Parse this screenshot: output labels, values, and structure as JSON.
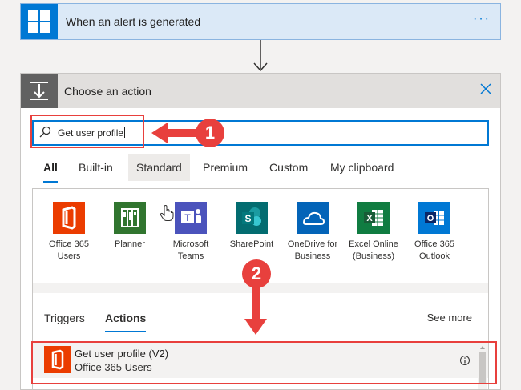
{
  "trigger": {
    "title": "When an alert is generated",
    "more": "···"
  },
  "action": {
    "title": "Choose an action",
    "search": {
      "value": "Get user profile"
    },
    "tabs": [
      "All",
      "Built-in",
      "Standard",
      "Premium",
      "Custom",
      "My clipboard"
    ],
    "connectors": [
      {
        "label": "Office 365 Users",
        "icon": "office-365-icon",
        "color": "#eb3c00"
      },
      {
        "label": "Planner",
        "icon": "planner-icon",
        "color": "#31752f"
      },
      {
        "label": "Microsoft Teams",
        "icon": "teams-icon",
        "color": "#4b53bc"
      },
      {
        "label": "SharePoint",
        "icon": "sharepoint-icon",
        "color": "#036c70"
      },
      {
        "label": "OneDrive for Business",
        "icon": "onedrive-icon",
        "color": "#0364b8"
      },
      {
        "label": "Excel Online (Business)",
        "icon": "excel-icon",
        "color": "#107c41"
      },
      {
        "label": "Office 365 Outlook",
        "icon": "outlook-icon",
        "color": "#0078d4"
      }
    ],
    "subtabs": [
      "Triggers",
      "Actions"
    ],
    "see_more": "See more",
    "results": [
      {
        "title": "Get user profile (V2)",
        "subtitle": "Office 365 Users"
      }
    ]
  },
  "annotations": {
    "callout_1": "1",
    "callout_2": "2"
  },
  "colors": {
    "accent": "#0078d4",
    "callout": "#e8403d"
  }
}
